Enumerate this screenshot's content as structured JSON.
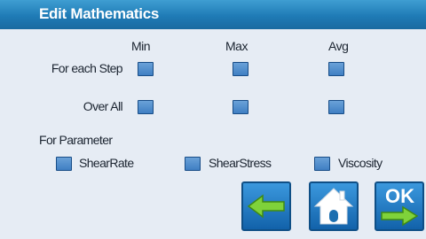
{
  "title": "Edit Mathematics",
  "columns": {
    "min": "Min",
    "max": "Max",
    "avg": "Avg"
  },
  "rows": {
    "each_step": "For each Step",
    "over_all": "Over All"
  },
  "parameter": {
    "heading": "For Parameter",
    "options": [
      "ShearRate",
      "ShearStress",
      "Viscosity"
    ]
  },
  "nav": {
    "back_icon": "left-arrow-icon",
    "home_icon": "home-icon",
    "ok_label": "OK"
  }
}
